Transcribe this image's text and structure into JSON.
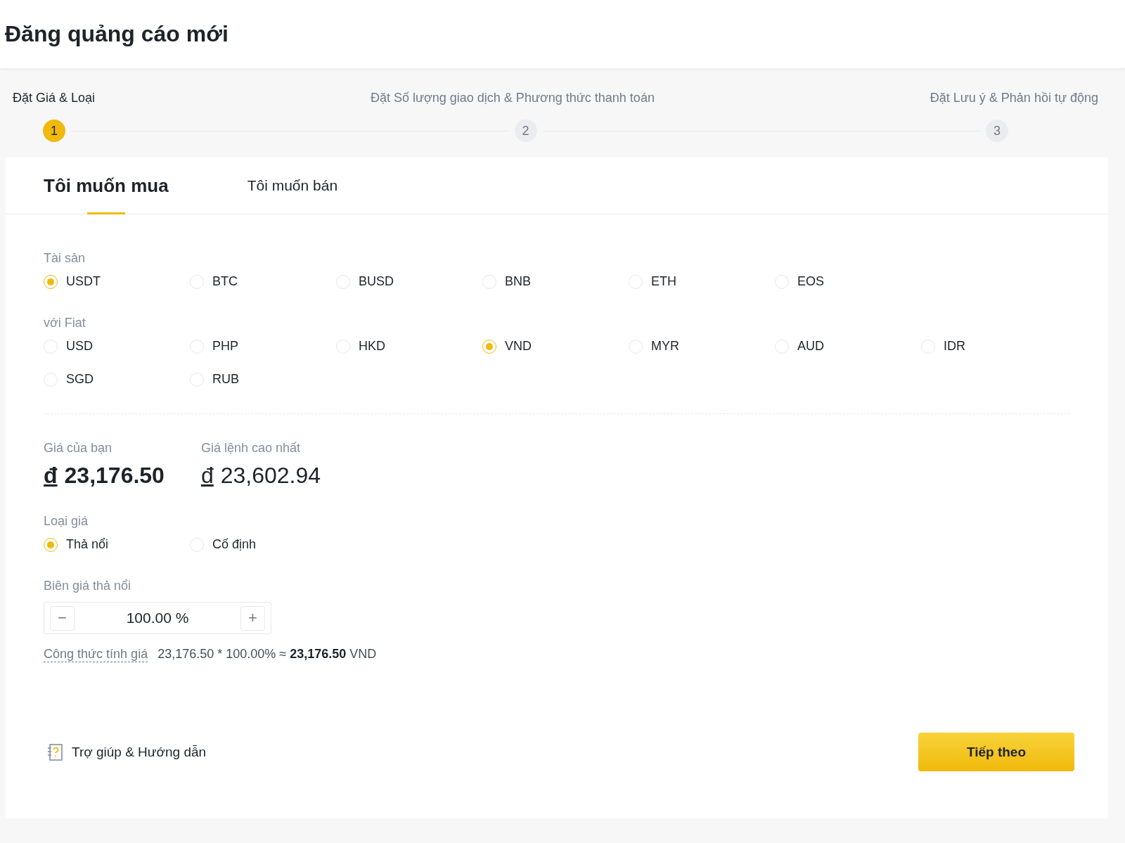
{
  "page_title": "Đăng quảng cáo mới",
  "steps": [
    {
      "label": "Đặt Giá & Loại",
      "number": "1",
      "selected": true
    },
    {
      "label": "Đặt Số lượng giao dịch & Phương thức thanh toán",
      "number": "2",
      "selected": false
    },
    {
      "label": "Đặt Lưu ý & Phản hồi tự động",
      "number": "3",
      "selected": false
    }
  ],
  "tabs": [
    {
      "label": "Tôi muốn mua",
      "selected": true
    },
    {
      "label": "Tôi muốn bán",
      "selected": false
    }
  ],
  "asset": {
    "label": "Tài sản",
    "options": [
      {
        "label": "USDT",
        "selected": true
      },
      {
        "label": "BTC",
        "selected": false
      },
      {
        "label": "BUSD",
        "selected": false
      },
      {
        "label": "BNB",
        "selected": false
      },
      {
        "label": "ETH",
        "selected": false
      },
      {
        "label": "EOS",
        "selected": false
      }
    ]
  },
  "fiat": {
    "label": "với Fiat",
    "options": [
      {
        "label": "USD",
        "selected": false
      },
      {
        "label": "PHP",
        "selected": false
      },
      {
        "label": "HKD",
        "selected": false
      },
      {
        "label": "VND",
        "selected": true
      },
      {
        "label": "MYR",
        "selected": false
      },
      {
        "label": "AUD",
        "selected": false
      },
      {
        "label": "IDR",
        "selected": false
      },
      {
        "label": "SGD",
        "selected": false
      },
      {
        "label": "RUB",
        "selected": false
      }
    ]
  },
  "prices": [
    {
      "label": "Giá của bạn",
      "currency": "đ",
      "value": "23,176.50",
      "kind": "own"
    },
    {
      "label": "Giá lệnh cao nhất",
      "currency": "đ",
      "value": "23,602.94",
      "kind": "market"
    }
  ],
  "price_type": {
    "label": "Loại giá",
    "options": [
      {
        "label": "Thả nổi",
        "selected": true
      },
      {
        "label": "Cố định",
        "selected": false
      }
    ]
  },
  "float_margin": {
    "label": "Biên giá thả nổi",
    "minus": "−",
    "value": "100.00 %",
    "plus": "+"
  },
  "formula": {
    "link": "Công thức tính giá",
    "text": "23,176.50 * 100.00% ≈ **23,176.50** VND"
  },
  "help": {
    "label": "Trợ giúp & Hướng dẫn"
  },
  "next_button": "Tiếp theo"
}
